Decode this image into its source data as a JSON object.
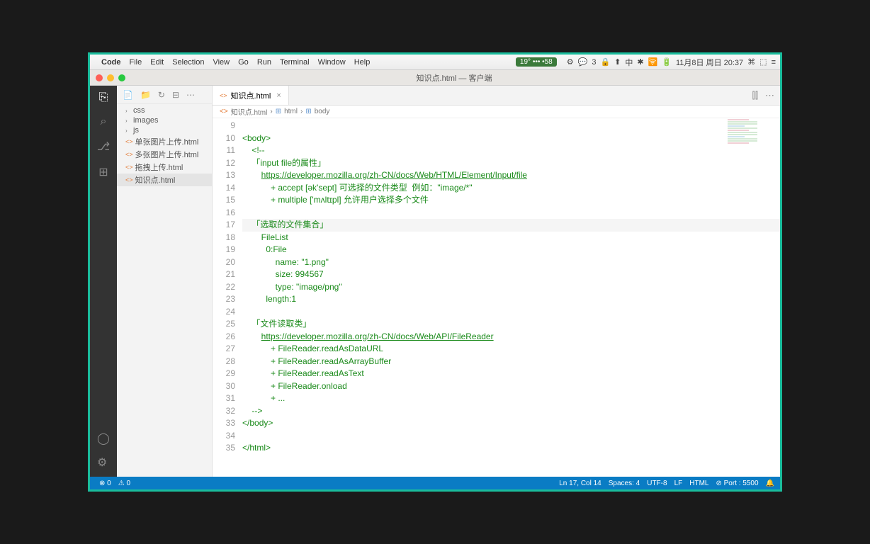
{
  "menubar": {
    "app": "Code",
    "items": [
      "File",
      "Edit",
      "Selection",
      "View",
      "Go",
      "Run",
      "Terminal",
      "Window",
      "Help"
    ],
    "pill": "19° ••• •58",
    "right": [
      "⚙",
      "💬",
      "3",
      "🔒",
      "⬆",
      "中",
      "✱",
      "🛜",
      "🔋",
      "11月8日 周日 20:37",
      "⌘",
      "⬚",
      "≡"
    ]
  },
  "titlebar": {
    "center": "知识点.html — 客户端"
  },
  "sidebar": {
    "folders": [
      "css",
      "images",
      "js"
    ],
    "files": [
      "单张图片上传.html",
      "多张图片上传.html",
      "拖拽上传.html",
      "知识点.html"
    ],
    "selected": "知识点.html"
  },
  "tab": {
    "name": "知识点.html"
  },
  "breadcrumb": {
    "file": "知识点.html",
    "el1": "html",
    "el2": "body"
  },
  "code": {
    "start": 9,
    "lines": [
      {
        "n": 9,
        "t": ""
      },
      {
        "n": 10,
        "t": "<body>",
        "cls": "c-tag"
      },
      {
        "n": 11,
        "t": "    <!--",
        "cls": "c-com"
      },
      {
        "n": 12,
        "t": "    「input file的属性」",
        "cls": "c-com"
      },
      {
        "n": 13,
        "pre": "        ",
        "link": "https://developer.mozilla.org/zh-CN/docs/Web/HTML/Element/Input/file"
      },
      {
        "n": 14,
        "t": "            + accept [ək'sept] 可选择的文件类型  例如：\"image/*\"",
        "cls": "c-com"
      },
      {
        "n": 15,
        "t": "            + multiple ['mʌltɪpl] 允许用户选择多个文件",
        "cls": "c-com"
      },
      {
        "n": 16,
        "t": "",
        "cls": "c-com"
      },
      {
        "n": 17,
        "t": "    「选取的文件集合」",
        "cls": "c-com",
        "cur": true
      },
      {
        "n": 18,
        "t": "        FileList",
        "cls": "c-com"
      },
      {
        "n": 19,
        "t": "          0:File",
        "cls": "c-com"
      },
      {
        "n": 20,
        "t": "              name: \"1.png\"",
        "cls": "c-com"
      },
      {
        "n": 21,
        "t": "              size: 994567",
        "cls": "c-com"
      },
      {
        "n": 22,
        "t": "              type: \"image/png\"",
        "cls": "c-com"
      },
      {
        "n": 23,
        "t": "          length:1",
        "cls": "c-com"
      },
      {
        "n": 24,
        "t": "",
        "cls": "c-com"
      },
      {
        "n": 25,
        "t": "    「文件读取类」",
        "cls": "c-com"
      },
      {
        "n": 26,
        "pre": "        ",
        "link": "https://developer.mozilla.org/zh-CN/docs/Web/API/FileReader"
      },
      {
        "n": 27,
        "t": "            + FileReader.readAsDataURL",
        "cls": "c-com"
      },
      {
        "n": 28,
        "t": "            + FileReader.readAsArrayBuffer",
        "cls": "c-com"
      },
      {
        "n": 29,
        "t": "            + FileReader.readAsText",
        "cls": "c-com"
      },
      {
        "n": 30,
        "t": "            + FileReader.onload",
        "cls": "c-com"
      },
      {
        "n": 31,
        "t": "            + ...",
        "cls": "c-com"
      },
      {
        "n": 32,
        "t": "    -->",
        "cls": "c-com"
      },
      {
        "n": 33,
        "t": "</body>",
        "cls": "c-tag"
      },
      {
        "n": 34,
        "t": ""
      },
      {
        "n": 35,
        "t": "</html>",
        "cls": "c-tag"
      }
    ]
  },
  "status": {
    "errors": "⊗ 0",
    "warnings": "⚠ 0",
    "pos": "Ln 17, Col 14",
    "spaces": "Spaces: 4",
    "enc": "UTF-8",
    "eol": "LF",
    "lang": "HTML",
    "port": "⊘ Port : 5500",
    "bell": "🔔"
  }
}
